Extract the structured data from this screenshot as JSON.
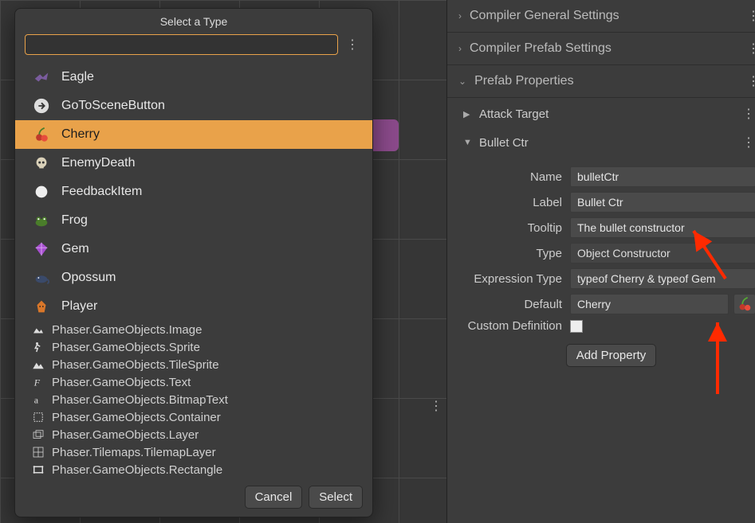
{
  "dialog": {
    "title": "Select a Type",
    "search_value": "",
    "search_placeholder": "",
    "items_custom": [
      {
        "label": "Eagle",
        "icon": "eagle",
        "selected": false
      },
      {
        "label": "GoToSceneButton",
        "icon": "arrow-right",
        "selected": false
      },
      {
        "label": "Cherry",
        "icon": "cherry",
        "selected": true
      },
      {
        "label": "EnemyDeath",
        "icon": "skull",
        "selected": false
      },
      {
        "label": "FeedbackItem",
        "icon": "circle",
        "selected": false
      },
      {
        "label": "Frog",
        "icon": "frog",
        "selected": false
      },
      {
        "label": "Gem",
        "icon": "gem",
        "selected": false
      },
      {
        "label": "Opossum",
        "icon": "opossum",
        "selected": false
      },
      {
        "label": "Player",
        "icon": "fox",
        "selected": false
      }
    ],
    "items_builtin": [
      {
        "label": "Phaser.GameObjects.Image",
        "icon": "image"
      },
      {
        "label": "Phaser.GameObjects.Sprite",
        "icon": "run"
      },
      {
        "label": "Phaser.GameObjects.TileSprite",
        "icon": "mountain"
      },
      {
        "label": "Phaser.GameObjects.Text",
        "icon": "font"
      },
      {
        "label": "Phaser.GameObjects.BitmapText",
        "icon": "bitmap"
      },
      {
        "label": "Phaser.GameObjects.Container",
        "icon": "container"
      },
      {
        "label": "Phaser.GameObjects.Layer",
        "icon": "layer"
      },
      {
        "label": "Phaser.Tilemaps.TilemapLayer",
        "icon": "grid"
      },
      {
        "label": "Phaser.GameObjects.Rectangle",
        "icon": "rect"
      }
    ],
    "cancel": "Cancel",
    "select": "Select"
  },
  "right": {
    "sections": [
      {
        "label": "Compiler General Settings",
        "open": false
      },
      {
        "label": "Compiler Prefab Settings",
        "open": false
      },
      {
        "label": "Prefab Properties",
        "open": true
      }
    ],
    "prefab_items": [
      {
        "label": "Attack Target",
        "open": false
      },
      {
        "label": "Bullet Ctr",
        "open": true
      }
    ],
    "form": {
      "name_label": "Name",
      "name_value": "bulletCtr",
      "label_label": "Label",
      "label_value": "Bullet Ctr",
      "tooltip_label": "Tooltip",
      "tooltip_value": "The bullet constructor",
      "type_label": "Type",
      "type_value": "Object Constructor",
      "expr_label": "Expression Type",
      "expr_value": "typeof Cherry & typeof Gem",
      "default_label": "Default",
      "default_value": "Cherry",
      "customdef_label": "Custom Definition",
      "add_label": "Add Property"
    }
  }
}
